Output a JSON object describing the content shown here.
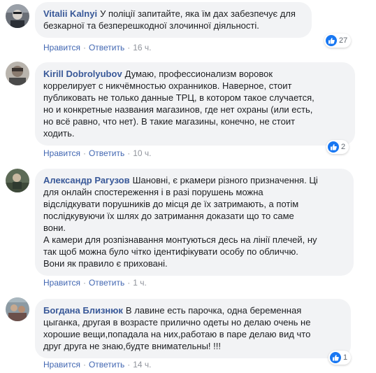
{
  "comments": [
    {
      "author": "Vitalii Kalnyi",
      "text": "У поліції запитайте, яка їм дах забезпечує для\nбезкарної та безперешкодної злочинної діяльності.",
      "like_label": "Нравится",
      "reply_label": "Ответить",
      "time": "16 ч.",
      "reaction_count": "27"
    },
    {
      "author": "Kirill Dobrolyubov",
      "text": "Думаю, профессионализм воровок\nкоррелирует с никчёмностью охранников. Наверное, стоит\nпубликовать не только данные ТРЦ, в котором такое случается,\nно и конкретные названия магазинов, где нет охраны (или есть,\nно всё равно, что нет). В такие магазины, конечно, не стоит\nходить.",
      "like_label": "Нравится",
      "reply_label": "Ответить",
      "time": "10 ч.",
      "reaction_count": "2"
    },
    {
      "author": "Александр Рагузов",
      "text": "Шановні, є ркамери різного призначення. Ці\nдля онлайн спостереження і в разі порушень можна\nвідслідкувати порушників до місця де їх затримають, а потім\nпослідкувуючи їх шлях до затримання доказати що то саме\nвони.\nА камери для розпізнавання монтуються десь на лінії плечей, ну\nтак щоб можна було чітко ідентифікувати особу по обличчю.\nВони як правило є приховані.",
      "like_label": "Нравится",
      "reply_label": "Ответить",
      "time": "1 ч."
    },
    {
      "author": "Богдана Близнюк",
      "text": "В лавине есть парочка, одна беременная\nцыганка, другая в возрасте прилично одеты но делаю очень не\nхорошие вещи,попадала на них,работаю в паре делаю вид что\nдруг друга не знаю,будте внимательны! !!!",
      "like_label": "Нравится",
      "reply_label": "Ответить",
      "time": "14 ч.",
      "reaction_count": "1"
    }
  ],
  "separator": "·",
  "colors": {
    "author": "#385898",
    "link": "#4267b2",
    "bubble": "#f2f3f5",
    "like_badge": "#1877f2",
    "meta": "#90949c"
  },
  "icons": {
    "reaction": "thumbs-up-icon"
  }
}
